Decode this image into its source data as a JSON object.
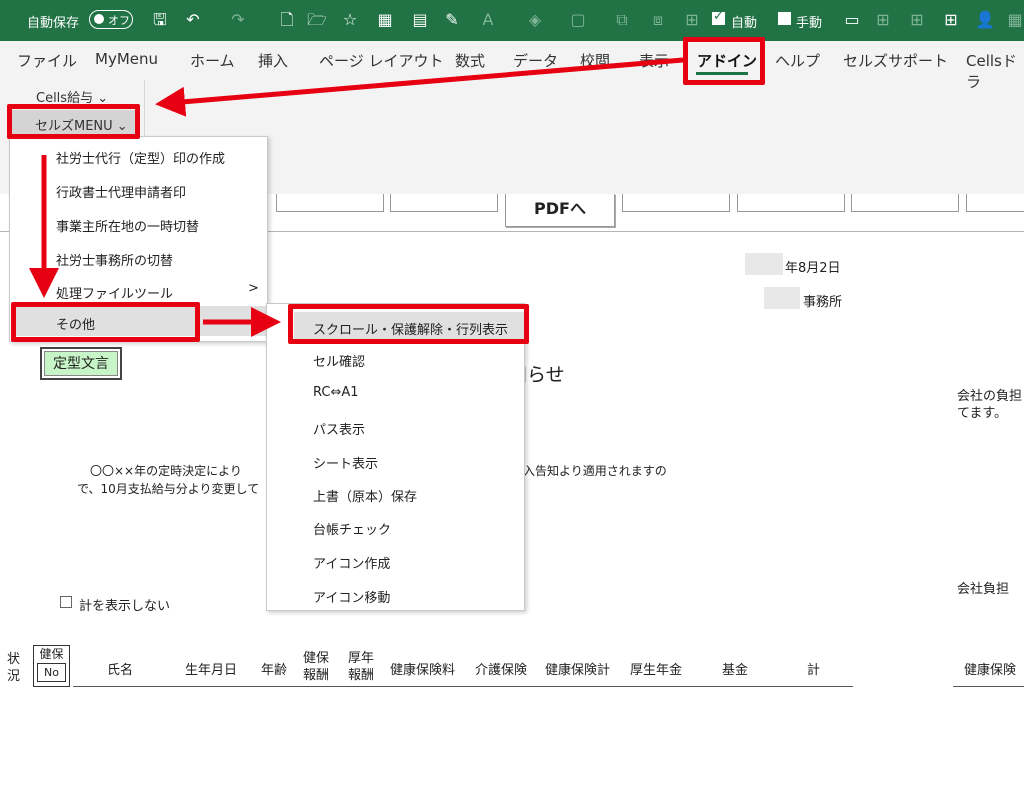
{
  "titlebar": {
    "autosave_label": "自動保存",
    "autosave_state": "オフ",
    "auto_label": "自動",
    "manual_label": "手動"
  },
  "tabs": [
    "ファイル",
    "MyMenu",
    "ホーム",
    "挿入",
    "ページ レイアウト",
    "数式",
    "データ",
    "校閲",
    "表示",
    "アドイン",
    "ヘルプ",
    "セルズサポート",
    "Cellsドラ"
  ],
  "ribbon": {
    "cells_kyuyo": "Cells給与 ⌄",
    "cellz_menu": "セルズMENU ⌄"
  },
  "main_menu": {
    "items": [
      "社労士代行（定型）印の作成",
      "行政書士代理申請者印",
      "事業主所在地の一時切替",
      "社労士事務所の切替",
      "処理ファイルツール",
      "その他"
    ],
    "submenu_arrow": ">"
  },
  "sub_menu": {
    "items": [
      "スクロール・保護解除・行列表示",
      "セル確認",
      "RC⇔A1",
      "パス表示",
      "シート表示",
      "上書（原本）保存",
      "台帳チェック",
      "アイコン作成",
      "アイコン移動"
    ]
  },
  "sheet": {
    "pdf_button": "PDFへ",
    "date": "年8月2日",
    "office": "事務所",
    "title_fragment": "知らせ",
    "teikei_button": "定型文言",
    "right_text_1": "会社の負担",
    "right_text_2": "てます。",
    "body_line_1_a": "〇〇××年の定時決定により",
    "body_line_1_b": "入告知より適用されますの",
    "body_line_2": "で、10月支払給与分より変更して",
    "right_text_3": "会社負担",
    "hide_total": "計を表示しない",
    "headers": {
      "status": [
        "状",
        "況"
      ],
      "kenpo_no": [
        "健保",
        "No"
      ],
      "name": "氏名",
      "birth": "生年月日",
      "age": "年齢",
      "kenpo_hoshu": [
        "健保",
        "報酬"
      ],
      "kosei_hoshu": [
        "厚年",
        "報酬"
      ],
      "kenko_hokenryo": "健康保険料",
      "kaigo": "介護保険",
      "kenko_kei": "健康保険計",
      "kosei_nenkin": "厚生年金",
      "kikin": "基金",
      "total": "計",
      "right_header": "健康保険"
    }
  },
  "colors": {
    "excel_green": "#217346",
    "highlight_red": "#e60012",
    "teikei_green": "#c7f5c7"
  }
}
